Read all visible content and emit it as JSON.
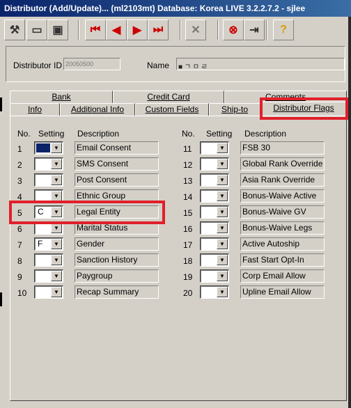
{
  "window": {
    "title": "Distributor (Add/Update)... (ml2103mt)  Database: Korea LIVE 3.2.2.7.2 - sjlee"
  },
  "toolbar": {
    "buttons": [
      {
        "name": "tool-icon",
        "glyph": "⚒"
      },
      {
        "name": "folder-icon",
        "glyph": "▭"
      },
      {
        "name": "save-icon",
        "glyph": "▣"
      },
      {
        "name": "first-record-icon",
        "glyph": "⏮"
      },
      {
        "name": "prev-record-icon",
        "glyph": "◀"
      },
      {
        "name": "next-record-icon",
        "glyph": "▶"
      },
      {
        "name": "last-record-icon",
        "glyph": "⏭"
      },
      {
        "name": "delete-icon",
        "glyph": "✕"
      },
      {
        "name": "cancel-icon",
        "glyph": "⊗"
      },
      {
        "name": "exit-icon",
        "glyph": "⇥"
      },
      {
        "name": "help-icon",
        "glyph": "?"
      }
    ]
  },
  "header": {
    "id_label": "Distributor ID",
    "id_value": "20050500",
    "name_label": "Name",
    "name_value": "■ ㄱ ㅁ ㄹ"
  },
  "tabs": {
    "back_row": [
      "Bank",
      "Credit Card",
      "Comments"
    ],
    "front_row": [
      "Info",
      "Additional Info",
      "Custom Fields",
      "Ship-to",
      "Distributor Flags"
    ],
    "active": "Distributor Flags"
  },
  "flags": {
    "col_no": "No.",
    "col_setting": "Setting",
    "col_desc": "Description",
    "left": [
      {
        "no": "1",
        "setting": "",
        "desc": "Email Consent",
        "selected": true
      },
      {
        "no": "2",
        "setting": "",
        "desc": "SMS Consent"
      },
      {
        "no": "3",
        "setting": "",
        "desc": "Post Consent"
      },
      {
        "no": "4",
        "setting": "",
        "desc": "Ethnic Group"
      },
      {
        "no": "5",
        "setting": "C",
        "desc": "Legal Entity"
      },
      {
        "no": "6",
        "setting": "",
        "desc": "Marital Status"
      },
      {
        "no": "7",
        "setting": "F",
        "desc": "Gender"
      },
      {
        "no": "8",
        "setting": "",
        "desc": "Sanction History"
      },
      {
        "no": "9",
        "setting": "",
        "desc": "Paygroup"
      },
      {
        "no": "10",
        "setting": "",
        "desc": "Recap Summary"
      }
    ],
    "right": [
      {
        "no": "11",
        "setting": "",
        "desc": "FSB 30"
      },
      {
        "no": "12",
        "setting": "",
        "desc": "Global Rank Override"
      },
      {
        "no": "13",
        "setting": "",
        "desc": "Asia Rank Override"
      },
      {
        "no": "14",
        "setting": "",
        "desc": "Bonus-Waive Active"
      },
      {
        "no": "15",
        "setting": "",
        "desc": "Bonus-Waive GV"
      },
      {
        "no": "16",
        "setting": "",
        "desc": "Bonus-Waive Legs"
      },
      {
        "no": "17",
        "setting": "",
        "desc": "Active Autoship"
      },
      {
        "no": "18",
        "setting": "",
        "desc": "Fast Start Opt-In"
      },
      {
        "no": "19",
        "setting": "",
        "desc": "Corp Email Allow"
      },
      {
        "no": "20",
        "setting": "",
        "desc": "Upline Email Allow"
      }
    ]
  },
  "colors": {
    "highlight": "#e0202a",
    "selection": "#0a246a",
    "title_bar": "#0a246a"
  }
}
